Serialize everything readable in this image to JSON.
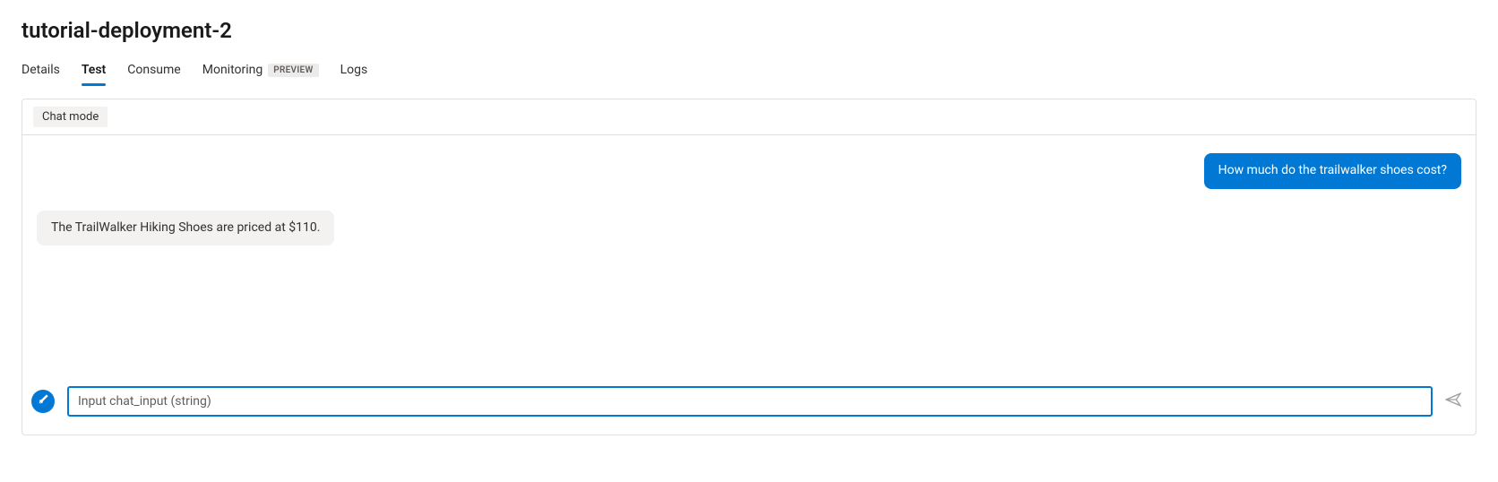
{
  "header": {
    "title": "tutorial-deployment-2"
  },
  "tabs": [
    {
      "label": "Details",
      "active": false,
      "badge": null
    },
    {
      "label": "Test",
      "active": true,
      "badge": null
    },
    {
      "label": "Consume",
      "active": false,
      "badge": null
    },
    {
      "label": "Monitoring",
      "active": false,
      "badge": "PREVIEW"
    },
    {
      "label": "Logs",
      "active": false,
      "badge": null
    }
  ],
  "panel": {
    "chat_mode_label": "Chat mode"
  },
  "chat": {
    "messages": [
      {
        "role": "user",
        "text": "How much do the trailwalker shoes cost?"
      },
      {
        "role": "assistant",
        "text": "The TrailWalker Hiking Shoes are priced at $110."
      }
    ],
    "input": {
      "value": "",
      "placeholder": "Input chat_input (string)"
    }
  }
}
